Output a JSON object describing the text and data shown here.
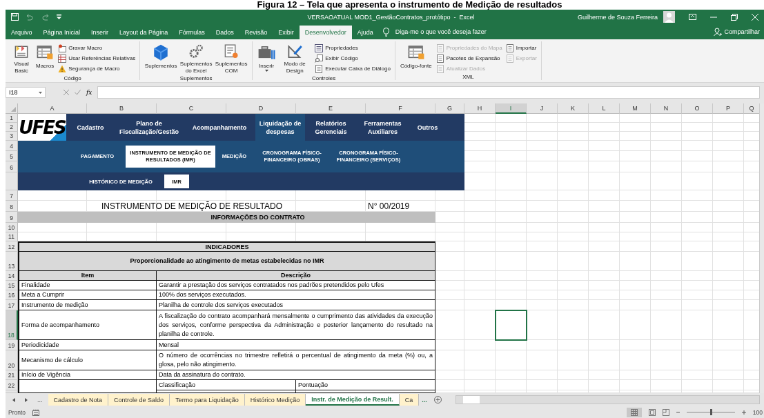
{
  "caption": "Figura 12 – Tela que apresenta o instrumento de Medição de resultados",
  "window": {
    "title": "VERSAOATUAL MOD1_GestãoContratos_protótipo  -  Excel",
    "user": "Guilherme de Souza Ferreira"
  },
  "ribbon_tabs": [
    {
      "label": "Arquivo",
      "selected": false
    },
    {
      "label": "Página Inicial",
      "selected": false
    },
    {
      "label": "Inserir",
      "selected": false
    },
    {
      "label": "Layout da Página",
      "selected": false
    },
    {
      "label": "Fórmulas",
      "selected": false
    },
    {
      "label": "Dados",
      "selected": false
    },
    {
      "label": "Revisão",
      "selected": false
    },
    {
      "label": "Exibir",
      "selected": false
    },
    {
      "label": "Desenvolvedor",
      "selected": true
    },
    {
      "label": "Ajuda",
      "selected": false
    }
  ],
  "tell_me": "Diga-me o que você deseja fazer",
  "share": "Compartilhar",
  "ribbon_groups": [
    {
      "label": "Código",
      "items": [
        {
          "label": "Visual Basic",
          "kind": "large",
          "disabled": false
        },
        {
          "label": "Macros",
          "kind": "large",
          "disabled": false
        },
        {
          "label": "Gravar Macro",
          "kind": "small",
          "disabled": false
        },
        {
          "label": "Usar Referências Relativas",
          "kind": "small",
          "disabled": false
        },
        {
          "label": "Segurança de Macro",
          "kind": "small",
          "disabled": false
        }
      ]
    },
    {
      "label": "Suplementos",
      "items": [
        {
          "label": "Suplementos",
          "kind": "large",
          "disabled": false
        },
        {
          "label": "Suplementos do Excel",
          "kind": "large",
          "disabled": false
        },
        {
          "label": "Suplementos COM",
          "kind": "large",
          "disabled": false
        }
      ]
    },
    {
      "label": "Controles",
      "items": [
        {
          "label": "Inserir",
          "kind": "large",
          "disabled": false
        },
        {
          "label": "Modo de Design",
          "kind": "large",
          "disabled": false
        },
        {
          "label": "Propriedades",
          "kind": "small",
          "disabled": false
        },
        {
          "label": "Exibir Código",
          "kind": "small",
          "disabled": false
        },
        {
          "label": "Executar Caixa de Diálogo",
          "kind": "small",
          "disabled": false
        }
      ]
    },
    {
      "label": "XML",
      "items": [
        {
          "label": "Código-fonte",
          "kind": "large",
          "disabled": false
        },
        {
          "label": "Propriedades do Mapa",
          "kind": "small",
          "disabled": true
        },
        {
          "label": "Pacotes de Expansão",
          "kind": "small",
          "disabled": false
        },
        {
          "label": "Atualizar Dados",
          "kind": "small",
          "disabled": true
        },
        {
          "label": "Importar",
          "kind": "small",
          "disabled": false
        },
        {
          "label": "Exportar",
          "kind": "small",
          "disabled": true
        }
      ]
    }
  ],
  "formula_bar": {
    "name_box": "I18",
    "function_label": "fx"
  },
  "columns": [
    {
      "label": "A",
      "selected": false
    },
    {
      "label": "B",
      "selected": false
    },
    {
      "label": "C",
      "selected": false
    },
    {
      "label": "D",
      "selected": false
    },
    {
      "label": "E",
      "selected": false
    },
    {
      "label": "F",
      "selected": false
    },
    {
      "label": "G",
      "selected": false
    },
    {
      "label": "H",
      "selected": false
    },
    {
      "label": "I",
      "selected": true
    },
    {
      "label": "J",
      "selected": false
    },
    {
      "label": "K",
      "selected": false
    },
    {
      "label": "L",
      "selected": false
    },
    {
      "label": "M",
      "selected": false
    },
    {
      "label": "N",
      "selected": false
    },
    {
      "label": "O",
      "selected": false
    },
    {
      "label": "P",
      "selected": false
    },
    {
      "label": "Q",
      "selected": false
    }
  ],
  "rows": [
    {
      "label": "1",
      "selected": false
    },
    {
      "label": "2",
      "selected": false
    },
    {
      "label": "3",
      "selected": false
    },
    {
      "label": "4",
      "selected": false
    },
    {
      "label": "5",
      "selected": false
    },
    {
      "label": "6",
      "selected": false
    },
    {
      "label": "7",
      "selected": false
    },
    {
      "label": "8",
      "selected": false
    },
    {
      "label": "9",
      "selected": false
    },
    {
      "label": "10",
      "selected": false
    },
    {
      "label": "11",
      "selected": false
    },
    {
      "label": "12",
      "selected": false
    },
    {
      "label": "13",
      "selected": false
    },
    {
      "label": "14",
      "selected": false
    },
    {
      "label": "15",
      "selected": false
    },
    {
      "label": "16",
      "selected": false
    },
    {
      "label": "17",
      "selected": false
    },
    {
      "label": "18",
      "selected": true
    },
    {
      "label": "19",
      "selected": false
    },
    {
      "label": "20",
      "selected": false
    },
    {
      "label": "21",
      "selected": false
    },
    {
      "label": "22",
      "selected": false
    }
  ],
  "banner": {
    "logo": "UFES",
    "menu": [
      {
        "label": "Cadastro",
        "selected": false
      },
      {
        "label": "Plano de Fiscalização/Gestão",
        "selected": false
      },
      {
        "label": "Acompanhamento",
        "selected": false
      },
      {
        "label": "Liquidação de despesas",
        "selected": true
      },
      {
        "label": "Relatórios Gerenciais",
        "selected": false
      },
      {
        "label": "Ferramentas Auxiliares",
        "selected": false
      },
      {
        "label": "Outros",
        "selected": false
      }
    ],
    "submenu": [
      {
        "label": "PAGAMENTO",
        "selected": false
      },
      {
        "label": "INSTRUMENTO DE MEDIÇÃO DE RESULTADOS (IMR)",
        "selected": true
      },
      {
        "label": "MEDIÇÃO",
        "selected": false
      },
      {
        "label": "CRONOGRAMA FÍSICO-FINANCEIRO (OBRAS)",
        "selected": false
      },
      {
        "label": "CRONOGRAMA FÍSICO-FINANCEIRO (SERVIÇOS)",
        "selected": false
      }
    ],
    "tabs": [
      {
        "label": "HISTÓRICO DE MEDIÇÃO",
        "selected": false
      },
      {
        "label": "IMR",
        "selected": true
      }
    ]
  },
  "sheet": {
    "title": "INSTRUMENTO DE MEDIÇÃO DE RESULTADO",
    "number": "N° 00/2019",
    "section": "INFORMAÇÕES DO CONTRATO",
    "indicators": "INDICADORES",
    "subtitle": "Proporcionalidade ao atingimento de metas estabelecidas no IMR",
    "headers": [
      "Item",
      "Descrição"
    ],
    "items": [
      {
        "item": "Finalidade",
        "description": "Garantir a prestação dos serviços contratados nos padrões pretendidos pelo Ufes"
      },
      {
        "item": "Meta a Cumprir",
        "description": "100% dos serviços executados."
      },
      {
        "item": "Instrumento de medição",
        "description": "Planilha de controle dos serviços executados"
      },
      {
        "item": "Forma de acompanhamento",
        "description": "A fiscalização do contrato acompanhará mensalmente o cumprimento das atividades da execução dos serviços, conforme perspectiva da Administração e posterior lançamento do resultado na planilha de controle."
      },
      {
        "item": "Periodicidade",
        "description": "Mensal"
      },
      {
        "item": "Mecanismo de cálculo",
        "description": "O número de ocorrências no trimestre refletirá o percentual de atingimento da meta (%) ou, a glosa, pelo não atingimento."
      },
      {
        "item": "Início de Vigência",
        "description": "Data da assinatura do contrato."
      }
    ],
    "classification": [
      "Classificação",
      "Pontuação"
    ]
  },
  "sheet_tabs": {
    "overflow_left": "...",
    "tabs": [
      {
        "label": "Cadastro de Nota",
        "selected": false
      },
      {
        "label": "Controle de Saldo",
        "selected": false
      },
      {
        "label": "Termo para Liquidação",
        "selected": false
      },
      {
        "label": "Histórico Medição",
        "selected": false
      },
      {
        "label": "Instr. de Medição de Result.",
        "selected": true
      },
      {
        "label": "Ca",
        "selected": false
      }
    ],
    "overflow_right": "..."
  },
  "status_bar": {
    "status": "Pronto",
    "zoom": "100",
    "zoom_slider": {
      "level": 0.5
    }
  }
}
